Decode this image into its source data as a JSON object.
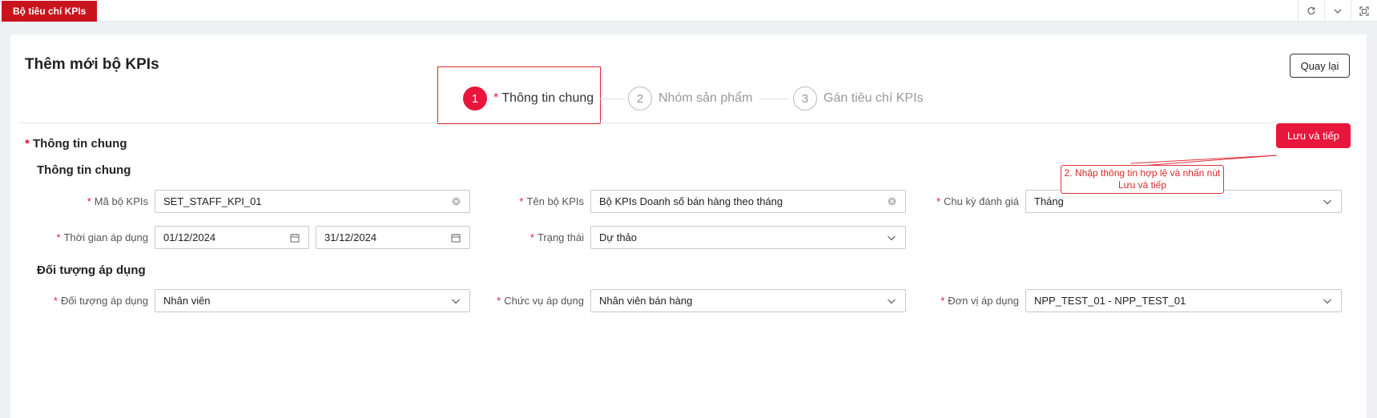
{
  "topbar": {
    "active_tab": "Bộ tiêu chí KPIs",
    "icons": [
      "refresh-icon",
      "chevron-down-icon",
      "fullscreen-icon"
    ]
  },
  "header": {
    "title": "Thêm mới bộ KPIs",
    "back_button": "Quay lại"
  },
  "steps": [
    {
      "number": "1",
      "label": "Thông tin chung",
      "required": "*",
      "active": true
    },
    {
      "number": "2",
      "label": "Nhóm sản phẩm",
      "active": false
    },
    {
      "number": "3",
      "label": "Gán tiêu chí KPIs",
      "active": false
    }
  ],
  "section": {
    "required": "*",
    "title": "Thông tin chung",
    "save_button": "Lưu và tiếp"
  },
  "annotation": {
    "text": "2. Nhập thông tin hợp lệ và nhấn nút Lưu và tiếp"
  },
  "general": {
    "title": "Thông tin chung",
    "fields": {
      "ma_bo_kpis": {
        "label": "Mã bộ KPIs",
        "value": "SET_STAFF_KPI_01"
      },
      "ten_bo_kpis": {
        "label": "Tên bộ KPIs",
        "value": "Bộ KPIs Doanh số bán hàng theo tháng"
      },
      "chu_ky": {
        "label": "Chu kỳ đánh giá",
        "value": "Tháng"
      },
      "thoi_gian": {
        "label": "Thời gian áp dụng",
        "from": "01/12/2024",
        "to": "31/12/2024"
      },
      "trang_thai": {
        "label": "Trạng thái",
        "value": "Dự thảo"
      }
    }
  },
  "target": {
    "title": "Đối tượng áp dụng",
    "fields": {
      "doi_tuong": {
        "label": "Đối tượng áp dụng",
        "value": "Nhân viên"
      },
      "chuc_vu": {
        "label": "Chức vụ áp dụng",
        "value": "Nhân viên bán hàng"
      },
      "don_vi": {
        "label": "Đơn vị áp dụng",
        "value": "NPP_TEST_01 - NPP_TEST_01"
      }
    }
  },
  "required_mark": "*",
  "colors": {
    "brand_red": "#e8163c",
    "tab_red": "#c9141e"
  }
}
